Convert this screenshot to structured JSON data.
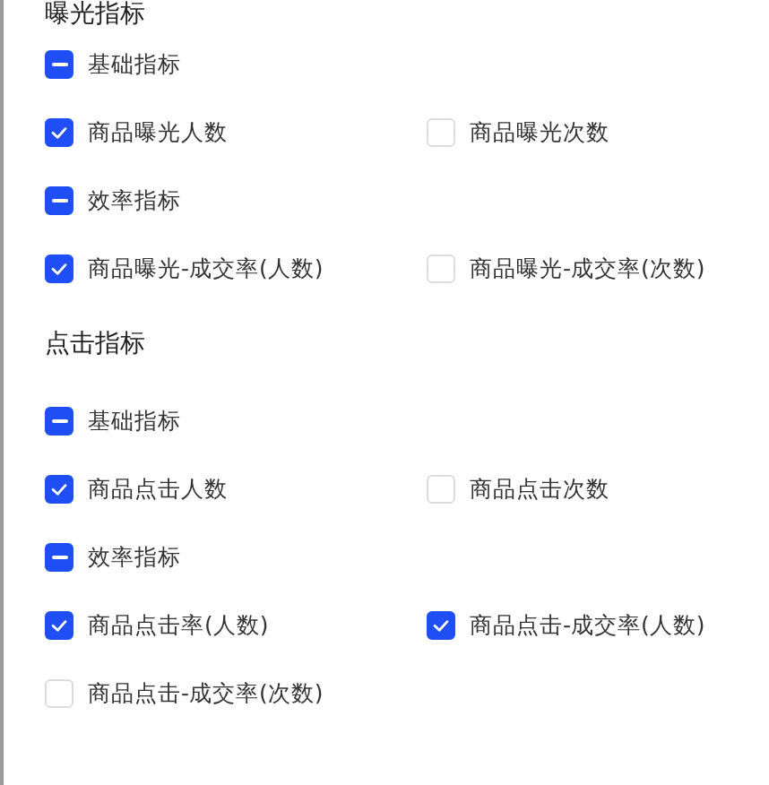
{
  "sections": [
    {
      "title": "曝光指标",
      "groups": [
        {
          "label": "基础指标",
          "indeterminate": true,
          "items": [
            {
              "label": "商品曝光人数",
              "checked": true
            },
            {
              "label": "商品曝光次数",
              "checked": false
            }
          ]
        },
        {
          "label": "效率指标",
          "indeterminate": true,
          "items": [
            {
              "label": "商品曝光-成交率(人数)",
              "checked": true
            },
            {
              "label": "商品曝光-成交率(次数)",
              "checked": false
            }
          ]
        }
      ]
    },
    {
      "title": "点击指标",
      "groups": [
        {
          "label": "基础指标",
          "indeterminate": true,
          "items": [
            {
              "label": "商品点击人数",
              "checked": true
            },
            {
              "label": "商品点击次数",
              "checked": false
            }
          ]
        },
        {
          "label": "效率指标",
          "indeterminate": true,
          "items": [
            {
              "label": "商品点击率(人数)",
              "checked": true
            },
            {
              "label": "商品点击-成交率(人数)",
              "checked": true
            },
            {
              "label": "商品点击-成交率(次数)",
              "checked": false
            }
          ]
        }
      ]
    }
  ]
}
